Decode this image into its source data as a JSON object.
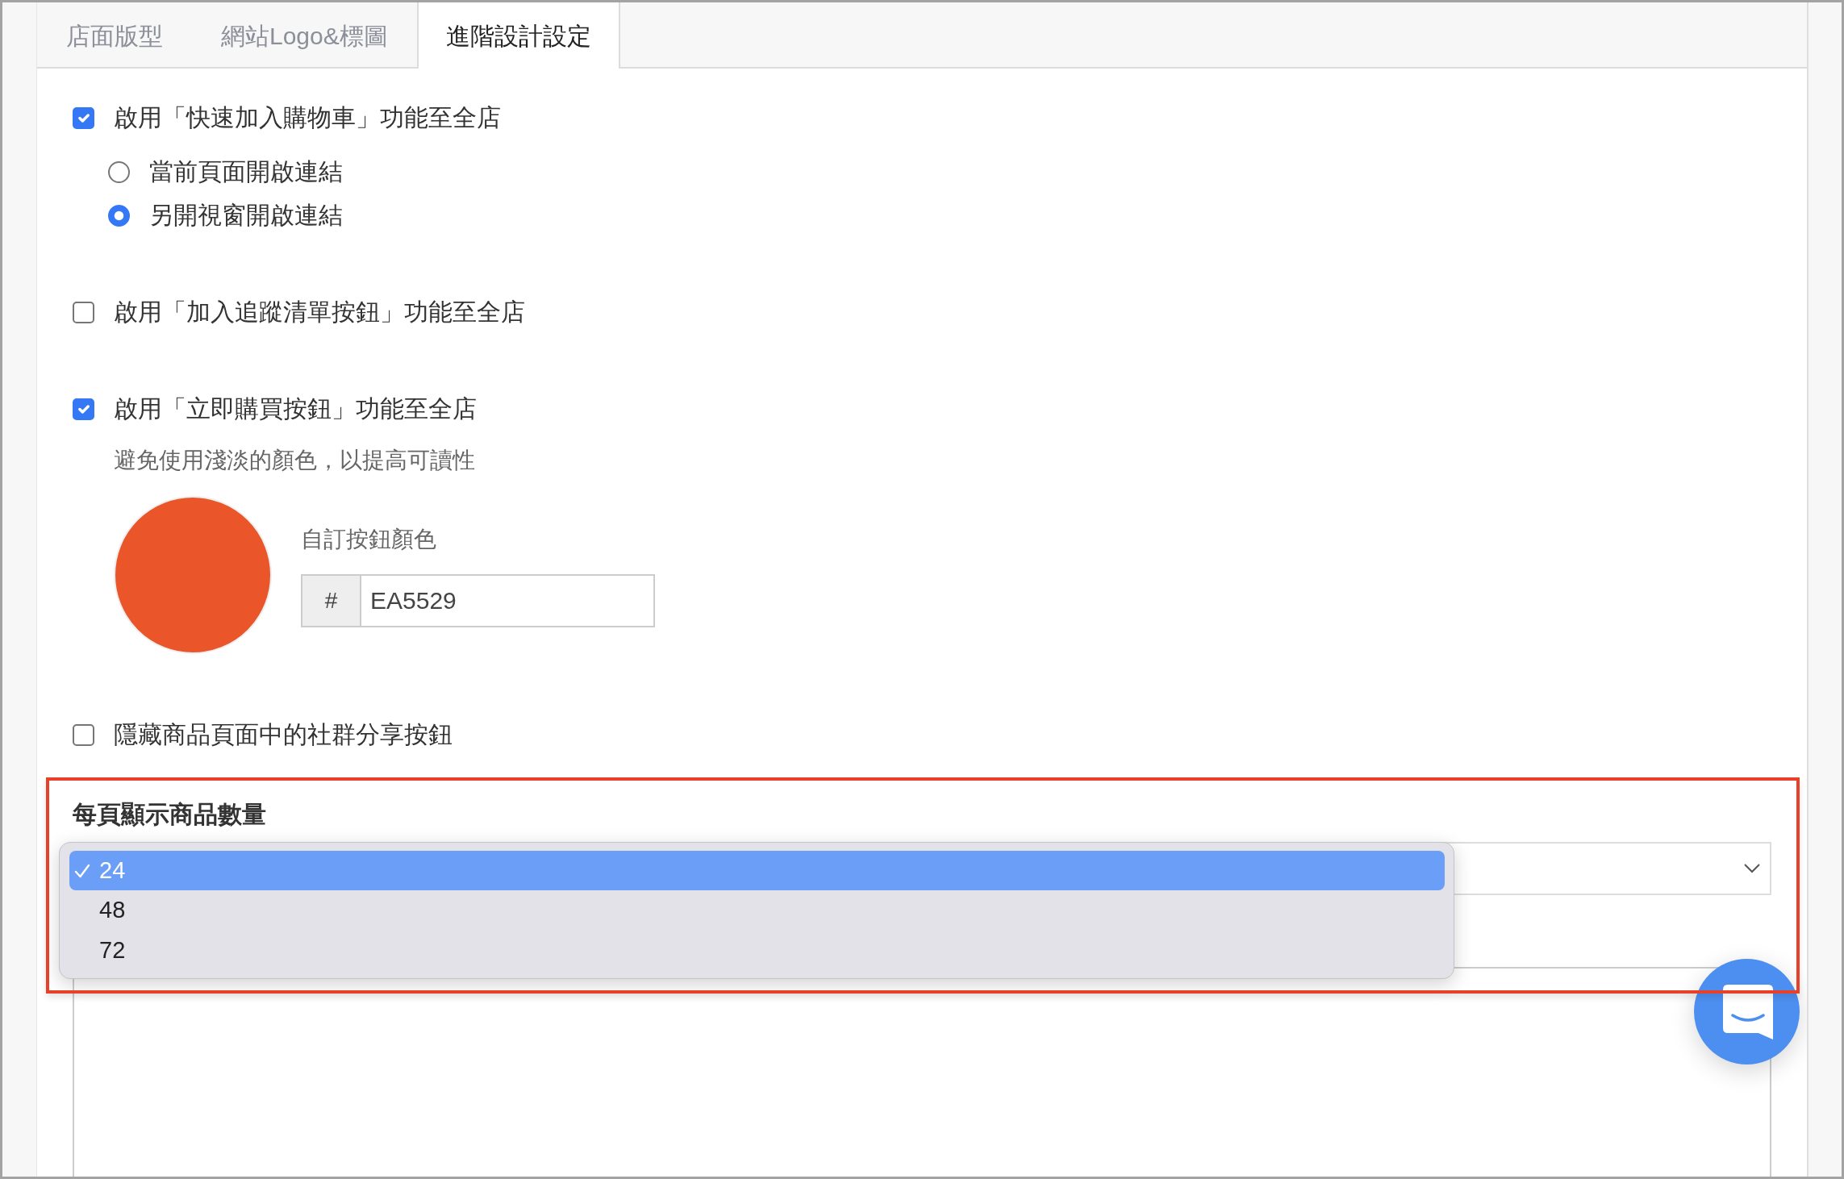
{
  "tabs": [
    {
      "label": "店面版型",
      "selected": false
    },
    {
      "label": "網站Logo&標圖",
      "selected": false
    },
    {
      "label": "進階設計設定",
      "selected": true
    }
  ],
  "settings": [
    {
      "label": "啟用「快速加入購物車」功能至全店",
      "checked": true,
      "options": [
        {
          "label": "當前頁面開啟連結",
          "selected": false
        },
        {
          "label": "另開視窗開啟連結",
          "selected": true
        }
      ]
    },
    {
      "label": "啟用「加入追蹤清單按鈕」功能至全店",
      "checked": false
    },
    {
      "label": "啟用「立即購買按鈕」功能至全店",
      "checked": true,
      "hint": "避免使用淺淡的顏色，以提高可讀性",
      "color_picker": {
        "label": "自訂按鈕顏色",
        "prefix": "#",
        "value": "EA5529"
      }
    },
    {
      "label": "隱藏商品頁面中的社群分享按鈕",
      "checked": false
    }
  ],
  "products_per_page": {
    "title": "每頁顯示商品數量",
    "highlighted": true,
    "dropdown": {
      "open": true,
      "options": [
        {
          "label": "24",
          "selected": true
        },
        {
          "label": "48",
          "selected": false
        },
        {
          "label": "72",
          "selected": false
        }
      ]
    }
  }
}
